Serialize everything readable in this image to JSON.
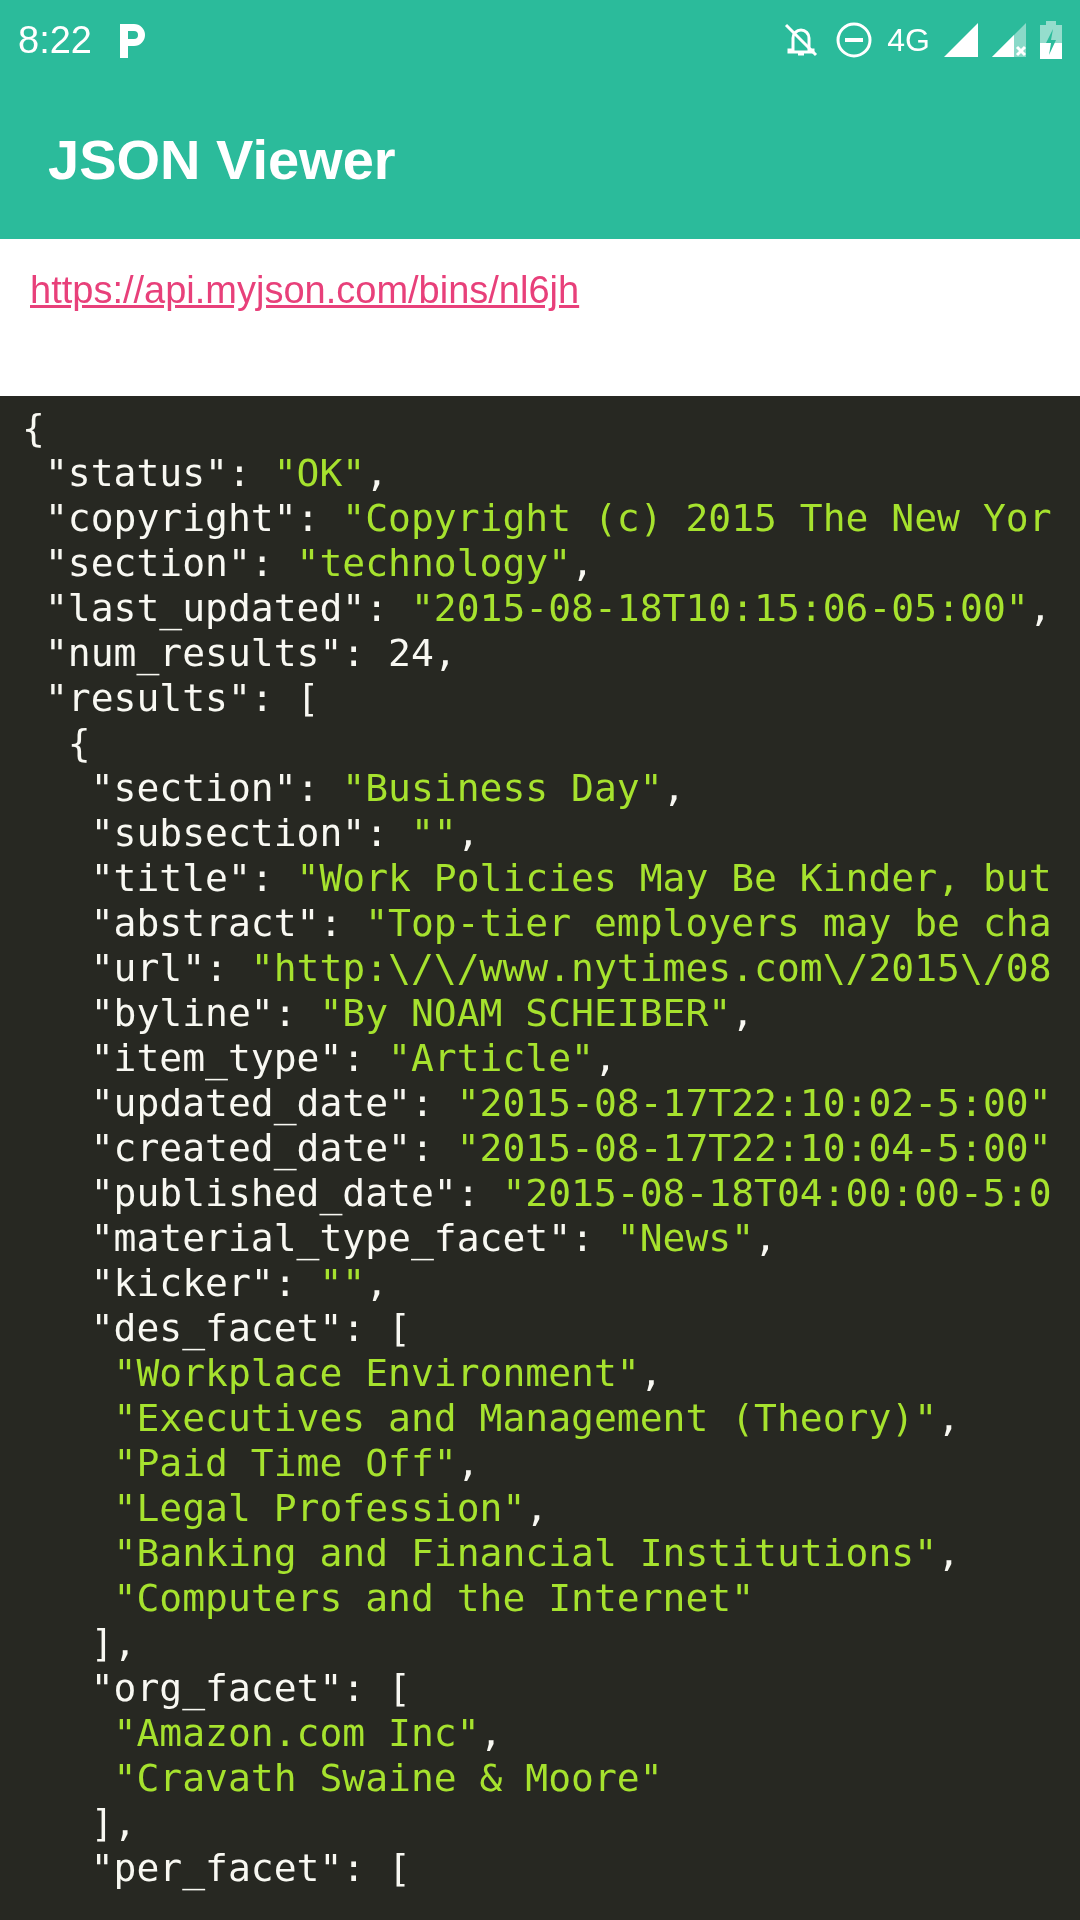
{
  "status_bar": {
    "time": "8:22",
    "network": "4G"
  },
  "app_bar": {
    "title": "JSON Viewer"
  },
  "url_link": "https://api.myjson.com/bins/nl6jh",
  "code_lines": [
    [
      {
        "text": "{",
        "kind": "plain"
      }
    ],
    [
      {
        "text": " \"status\": ",
        "kind": "plain"
      },
      {
        "text": "\"OK\"",
        "kind": "string"
      },
      {
        "text": ",",
        "kind": "plain"
      }
    ],
    [
      {
        "text": " \"copyright\": ",
        "kind": "plain"
      },
      {
        "text": "\"Copyright (c) 2015 The New Yor",
        "kind": "string"
      }
    ],
    [
      {
        "text": " \"section\": ",
        "kind": "plain"
      },
      {
        "text": "\"technology\"",
        "kind": "string"
      },
      {
        "text": ",",
        "kind": "plain"
      }
    ],
    [
      {
        "text": " \"last_updated\": ",
        "kind": "plain"
      },
      {
        "text": "\"2015-08-18T10:15:06-05:00\"",
        "kind": "string"
      },
      {
        "text": ",",
        "kind": "plain"
      }
    ],
    [
      {
        "text": " \"num_results\": 24,",
        "kind": "plain"
      }
    ],
    [
      {
        "text": " \"results\": [",
        "kind": "plain"
      }
    ],
    [
      {
        "text": "  {",
        "kind": "plain"
      }
    ],
    [
      {
        "text": "   \"section\": ",
        "kind": "plain"
      },
      {
        "text": "\"Business Day\"",
        "kind": "string"
      },
      {
        "text": ",",
        "kind": "plain"
      }
    ],
    [
      {
        "text": "   \"subsection\": ",
        "kind": "plain"
      },
      {
        "text": "\"\"",
        "kind": "string"
      },
      {
        "text": ",",
        "kind": "plain"
      }
    ],
    [
      {
        "text": "   \"title\": ",
        "kind": "plain"
      },
      {
        "text": "\"Work Policies May Be Kinder, but",
        "kind": "string"
      }
    ],
    [
      {
        "text": "   \"abstract\": ",
        "kind": "plain"
      },
      {
        "text": "\"Top-tier employers may be cha",
        "kind": "string"
      }
    ],
    [
      {
        "text": "   \"url\": ",
        "kind": "plain"
      },
      {
        "text": "\"http:\\/\\/www.nytimes.com\\/2015\\/08",
        "kind": "string"
      }
    ],
    [
      {
        "text": "   \"byline\": ",
        "kind": "plain"
      },
      {
        "text": "\"By NOAM SCHEIBER\"",
        "kind": "string"
      },
      {
        "text": ",",
        "kind": "plain"
      }
    ],
    [
      {
        "text": "   \"item_type\": ",
        "kind": "plain"
      },
      {
        "text": "\"Article\"",
        "kind": "string"
      },
      {
        "text": ",",
        "kind": "plain"
      }
    ],
    [
      {
        "text": "   \"updated_date\": ",
        "kind": "plain"
      },
      {
        "text": "\"2015-08-17T22:10:02-5:00\"",
        "kind": "string"
      }
    ],
    [
      {
        "text": "   \"created_date\": ",
        "kind": "plain"
      },
      {
        "text": "\"2015-08-17T22:10:04-5:00\"",
        "kind": "string"
      }
    ],
    [
      {
        "text": "   \"published_date\": ",
        "kind": "plain"
      },
      {
        "text": "\"2015-08-18T04:00:00-5:0",
        "kind": "string"
      }
    ],
    [
      {
        "text": "   \"material_type_facet\": ",
        "kind": "plain"
      },
      {
        "text": "\"News\"",
        "kind": "string"
      },
      {
        "text": ",",
        "kind": "plain"
      }
    ],
    [
      {
        "text": "   \"kicker\": ",
        "kind": "plain"
      },
      {
        "text": "\"\"",
        "kind": "string"
      },
      {
        "text": ",",
        "kind": "plain"
      }
    ],
    [
      {
        "text": "   \"des_facet\": [",
        "kind": "plain"
      }
    ],
    [
      {
        "text": "    \"Workplace Environment\"",
        "kind": "string"
      },
      {
        "text": ",",
        "kind": "plain"
      }
    ],
    [
      {
        "text": "    \"Executives and Management (Theory)\"",
        "kind": "string"
      },
      {
        "text": ",",
        "kind": "plain"
      }
    ],
    [
      {
        "text": "    \"Paid Time Off\"",
        "kind": "string"
      },
      {
        "text": ",",
        "kind": "plain"
      }
    ],
    [
      {
        "text": "    \"Legal Profession\"",
        "kind": "string"
      },
      {
        "text": ",",
        "kind": "plain"
      }
    ],
    [
      {
        "text": "    \"Banking and Financial Institutions\"",
        "kind": "string"
      },
      {
        "text": ",",
        "kind": "plain"
      }
    ],
    [
      {
        "text": "    \"Computers and the Internet\"",
        "kind": "string"
      }
    ],
    [
      {
        "text": "   ],",
        "kind": "plain"
      }
    ],
    [
      {
        "text": "   \"org_facet\": [",
        "kind": "plain"
      }
    ],
    [
      {
        "text": "    \"Amazon.com Inc\"",
        "kind": "string"
      },
      {
        "text": ",",
        "kind": "plain"
      }
    ],
    [
      {
        "text": "    \"Cravath Swaine & Moore\"",
        "kind": "string"
      }
    ],
    [
      {
        "text": "   ],",
        "kind": "plain"
      }
    ],
    [
      {
        "text": "   \"per_facet\": [",
        "kind": "plain"
      }
    ]
  ]
}
